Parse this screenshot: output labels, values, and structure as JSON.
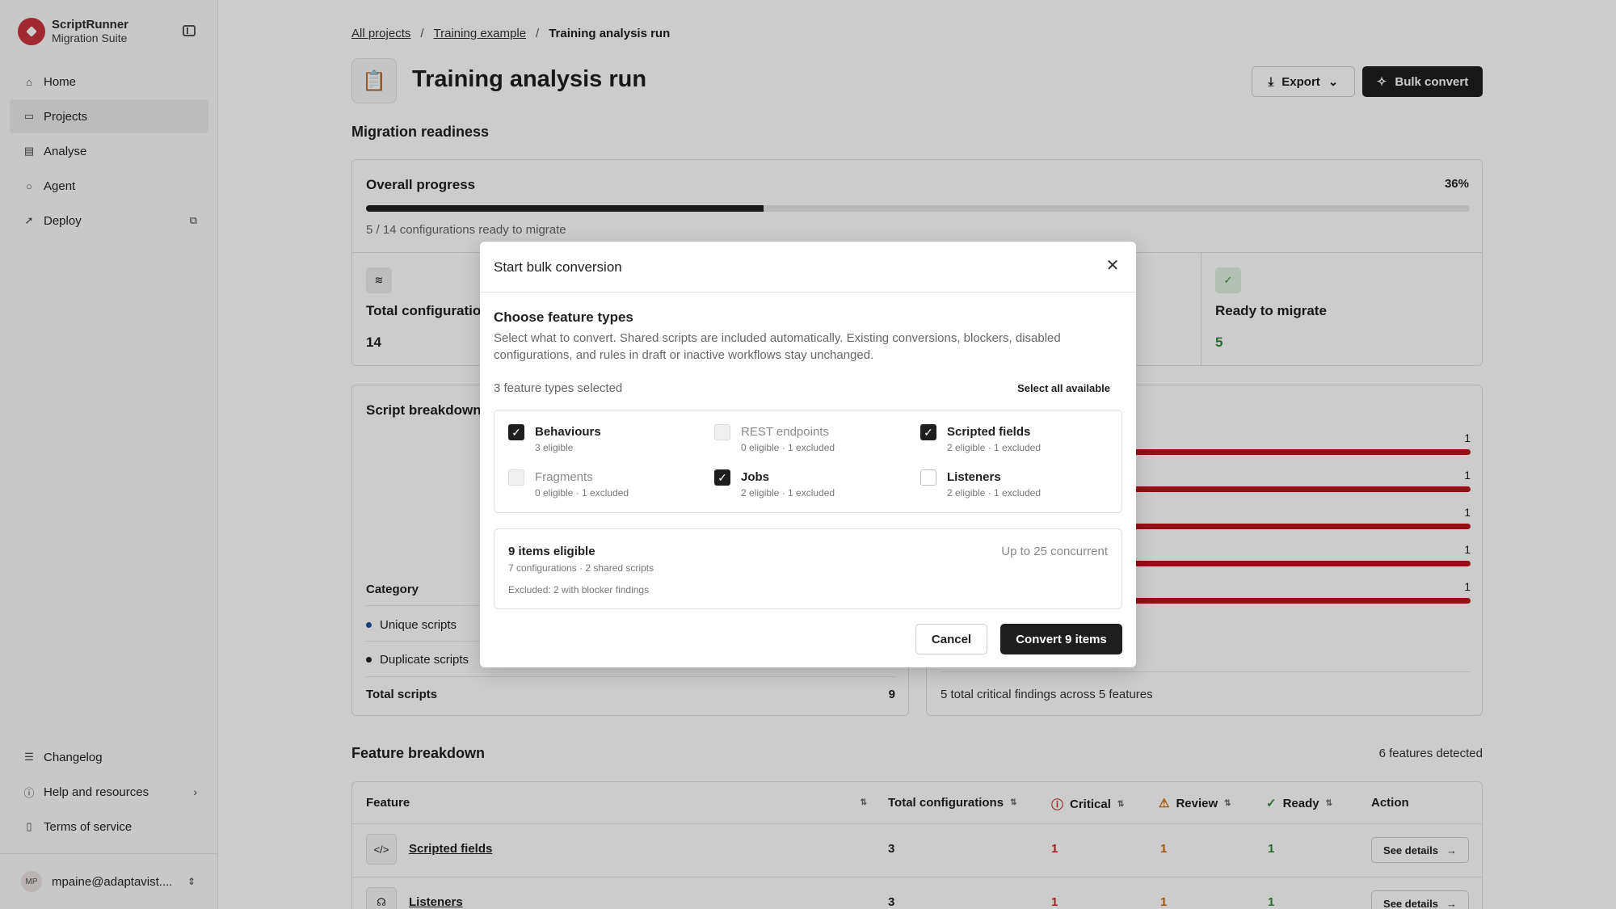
{
  "brand": {
    "name": "ScriptRunner",
    "subtitle": "Migration Suite"
  },
  "sidebar": {
    "items": [
      {
        "label": "Home",
        "icon": "home-icon"
      },
      {
        "label": "Projects",
        "icon": "folder-icon",
        "active": true
      },
      {
        "label": "Analyse",
        "icon": "clipboard-icon"
      },
      {
        "label": "Agent",
        "icon": "chat-icon"
      },
      {
        "label": "Deploy",
        "icon": "rocket-icon"
      }
    ],
    "bottom": [
      {
        "label": "Changelog",
        "icon": "list-icon"
      },
      {
        "label": "Help and resources",
        "icon": "info-icon"
      },
      {
        "label": "Terms of service",
        "icon": "document-icon"
      }
    ],
    "user": {
      "initials": "MP",
      "email": "mpaine@adaptavist...."
    }
  },
  "breadcrumb": {
    "items": [
      "All projects",
      "Training example"
    ],
    "current": "Training analysis run",
    "separator": "/"
  },
  "page": {
    "title": "Training analysis run"
  },
  "actions": {
    "export": "Export",
    "bulk_convert": "Bulk convert"
  },
  "readiness": {
    "title": "Migration readiness",
    "overall": {
      "title": "Overall progress",
      "percent_label": "36%",
      "percent": 36,
      "caption": "5 / 14 configurations ready to migrate"
    },
    "stats": [
      {
        "label": "Total configuratio",
        "value": "14"
      },
      {
        "label": "Ready to migrate",
        "value": "5"
      }
    ]
  },
  "script_breakdown": {
    "title": "Script breakdown",
    "category_header": "Category",
    "categories": [
      {
        "label": "Unique scripts",
        "color": "#1f4fa0"
      },
      {
        "label": "Duplicate scripts",
        "color": "#222222"
      }
    ],
    "total_label": "Total scripts",
    "total_value": "9"
  },
  "critical": {
    "counts": [
      "1",
      "1",
      "1",
      "1",
      "1"
    ],
    "fraction": 1.0,
    "footer": "5 total critical findings across 5 features"
  },
  "features": {
    "title": "Feature breakdown",
    "count_label": "6 features detected",
    "headers": {
      "feature": "Feature",
      "total": "Total configurations",
      "critical": "Critical",
      "review": "Review",
      "ready": "Ready",
      "action": "Action"
    },
    "rows": [
      {
        "name": "Scripted fields",
        "total": "3",
        "critical": "1",
        "review": "1",
        "ready": "1",
        "action": "See details"
      },
      {
        "name": "Listeners",
        "total": "3",
        "critical": "1",
        "review": "1",
        "ready": "1",
        "action": "See details"
      }
    ]
  },
  "modal": {
    "title": "Start bulk conversion",
    "heading": "Choose feature types",
    "description": "Select what to convert. Shared scripts are included automatically. Existing conversions, blockers, disabled configurations, and rules in draft or inactive workflows stay unchanged.",
    "selected_count": "3 feature types selected",
    "select_all": "Select all available",
    "options": [
      {
        "label": "Behaviours",
        "sub": "3 eligible",
        "checked": true,
        "disabled": false
      },
      {
        "label": "REST endpoints",
        "sub": "0 eligible · 1 excluded",
        "checked": false,
        "disabled": true
      },
      {
        "label": "Scripted fields",
        "sub": "2 eligible · 1 excluded",
        "checked": true,
        "disabled": false
      },
      {
        "label": "Fragments",
        "sub": "0 eligible · 1 excluded",
        "checked": false,
        "disabled": true
      },
      {
        "label": "Jobs",
        "sub": "2 eligible · 1 excluded",
        "checked": true,
        "disabled": false
      },
      {
        "label": "Listeners",
        "sub": "2 eligible · 1 excluded",
        "checked": false,
        "disabled": false
      }
    ],
    "eligible": {
      "title": "9 items eligible",
      "concurrent": "Up to 25 concurrent",
      "sub": "7 configurations · 2 shared scripts",
      "excluded": "Excluded: 2 with blocker findings"
    },
    "cancel": "Cancel",
    "convert": "Convert 9 items"
  }
}
